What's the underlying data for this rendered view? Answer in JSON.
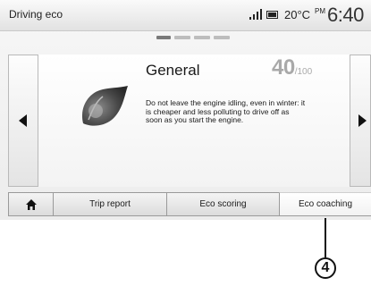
{
  "status_bar": {
    "title": "Driving eco",
    "temperature": "20°C",
    "ampm": "PM",
    "time": "6:40"
  },
  "pager": {
    "pages": 4,
    "active_index": 0
  },
  "card": {
    "title": "General",
    "score_value": "40",
    "score_total": "/100",
    "text": "Do not leave the engine idling, even in winter: it is cheaper and less polluting to drive off as soon as you start the engine."
  },
  "tabs": {
    "home_icon": "home-icon",
    "trip_report": "Trip report",
    "eco_scoring": "Eco scoring",
    "eco_coaching": "Eco coaching"
  },
  "callout": {
    "number": "4"
  }
}
